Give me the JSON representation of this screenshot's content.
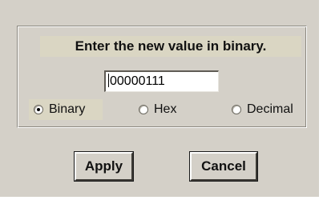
{
  "dialog": {
    "prompt": "Enter the new value in binary.",
    "value": "00000111",
    "radios": [
      {
        "label": "Binary",
        "selected": true
      },
      {
        "label": "Hex",
        "selected": false
      },
      {
        "label": "Decimal",
        "selected": false
      }
    ],
    "apply_label": "Apply",
    "cancel_label": "Cancel"
  }
}
